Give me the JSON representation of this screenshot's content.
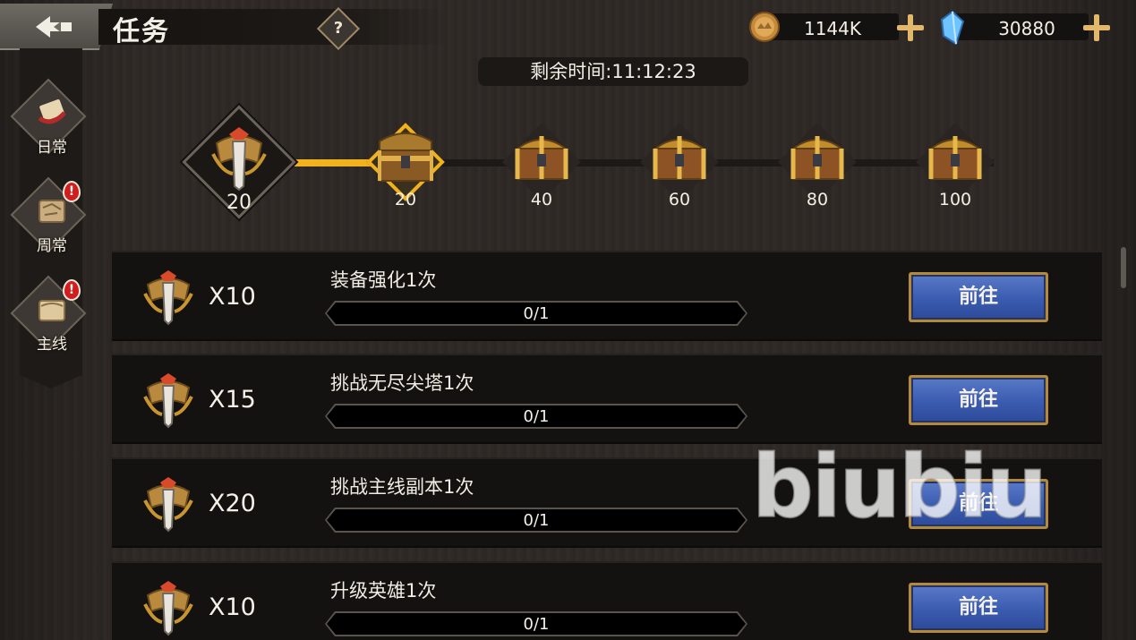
{
  "header": {
    "title": "任务",
    "help_label": "?",
    "gold": "1144K",
    "gems": "30880"
  },
  "timer": "剩余时间:11:12:23",
  "sidebar": {
    "tabs": [
      {
        "label": "日常",
        "alert": false
      },
      {
        "label": "周常",
        "alert": true,
        "alert_mark": "!"
      },
      {
        "label": "主线",
        "alert": true,
        "alert_mark": "!"
      }
    ]
  },
  "progress": {
    "current": "20",
    "milestones": [
      "20",
      "40",
      "60",
      "80",
      "100"
    ],
    "active_index": 0,
    "fill_fraction": 0.2
  },
  "tasks": [
    {
      "reward": "X10",
      "name": "装备强化1次",
      "progress": "0/1",
      "button": "前往"
    },
    {
      "reward": "X15",
      "name": "挑战无尽尖塔1次",
      "progress": "0/1",
      "button": "前往"
    },
    {
      "reward": "X20",
      "name": "挑战主线副本1次",
      "progress": "0/1",
      "button": "前往"
    },
    {
      "reward": "X10",
      "name": "升级英雄1次",
      "progress": "0/1",
      "button": "前往"
    }
  ],
  "watermark": "biubiu",
  "colors": {
    "accent_gold": "#f2b21e",
    "button_blue": "#3a5bb0",
    "alert_red": "#d01d1d"
  }
}
